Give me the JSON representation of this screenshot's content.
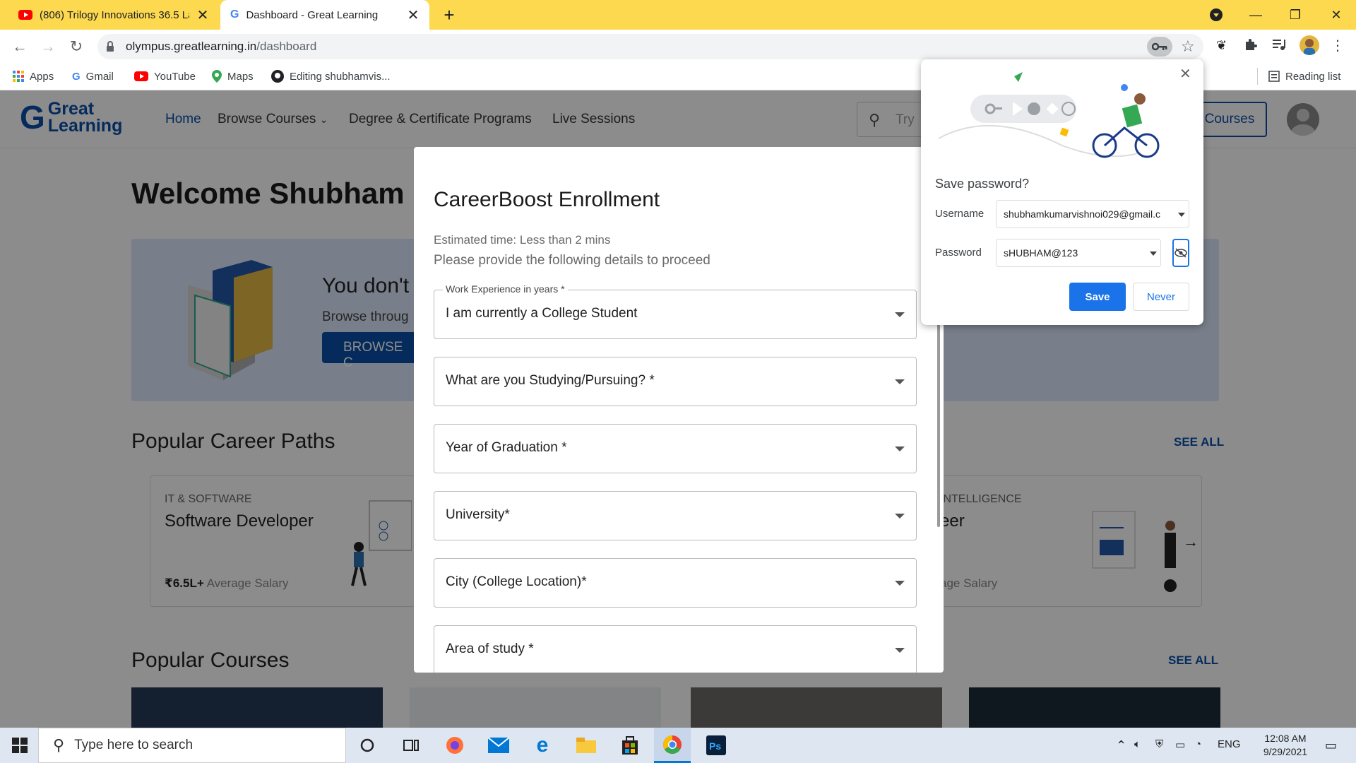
{
  "browser": {
    "tabs": [
      {
        "title": "(806) Trilogy Innovations 36.5 Lakh",
        "icon": "youtube-icon",
        "active": false
      },
      {
        "title": "Dashboard - Great Learning",
        "icon": "google-icon",
        "active": true
      }
    ],
    "url_domain": "olympus.greatlearning.in",
    "url_path": "/dashboard",
    "bookmarks": [
      "Apps",
      "Gmail",
      "YouTube",
      "Maps",
      "Editing shubhamvis..."
    ],
    "reading_list": "Reading list"
  },
  "site": {
    "logo_line1": "Great",
    "logo_line2": "Learning",
    "nav": [
      "Home",
      "Browse Courses",
      "Degree & Certificate Programs",
      "Live Sessions"
    ],
    "search_placeholder": "Try",
    "courses_button": "Courses",
    "welcome": "Welcome Shubham K",
    "banner_title": "You don't",
    "banner_text": "Browse throug",
    "banner_button": "BROWSE C",
    "section_career": "Popular Career Paths",
    "see_all": "SEE ALL",
    "section_courses": "Popular Courses",
    "career_cards": [
      {
        "category": "IT & SOFTWARE",
        "title": "Software Developer",
        "salary_value": "₹6.5L+",
        "salary_label": "Average Salary"
      },
      {
        "category": "INTELLIGENCE",
        "title": "eer",
        "salary_value": "",
        "salary_label": "age Salary"
      }
    ]
  },
  "modal": {
    "title": "CareerBoost Enrollment",
    "estimated": "Estimated time: Less than 2 mins",
    "instructions": "Please provide the following details to proceed",
    "fields": [
      {
        "label": "Work Experience in years *",
        "value": "I am currently a College Student"
      },
      {
        "label": "",
        "value": "What are you Studying/Pursuing? *"
      },
      {
        "label": "",
        "value": "Year of Graduation *"
      },
      {
        "label": "",
        "value": "University*"
      },
      {
        "label": "",
        "value": "City (College Location)*"
      },
      {
        "label": "",
        "value": "Area of study *"
      }
    ]
  },
  "password_popup": {
    "title": "Save password?",
    "username_label": "Username",
    "username_value": "shubhamkumarvishnoi029@gmail.c",
    "password_label": "Password",
    "password_value": "sHUBHAM@123",
    "save": "Save",
    "never": "Never"
  },
  "taskbar": {
    "search_placeholder": "Type here to search",
    "lang": "ENG",
    "time": "12:08 AM",
    "date": "9/29/2021"
  },
  "colors": {
    "tabstrip": "#fcd94f",
    "brand": "#0a4fa8",
    "save_button": "#1a73e8"
  }
}
